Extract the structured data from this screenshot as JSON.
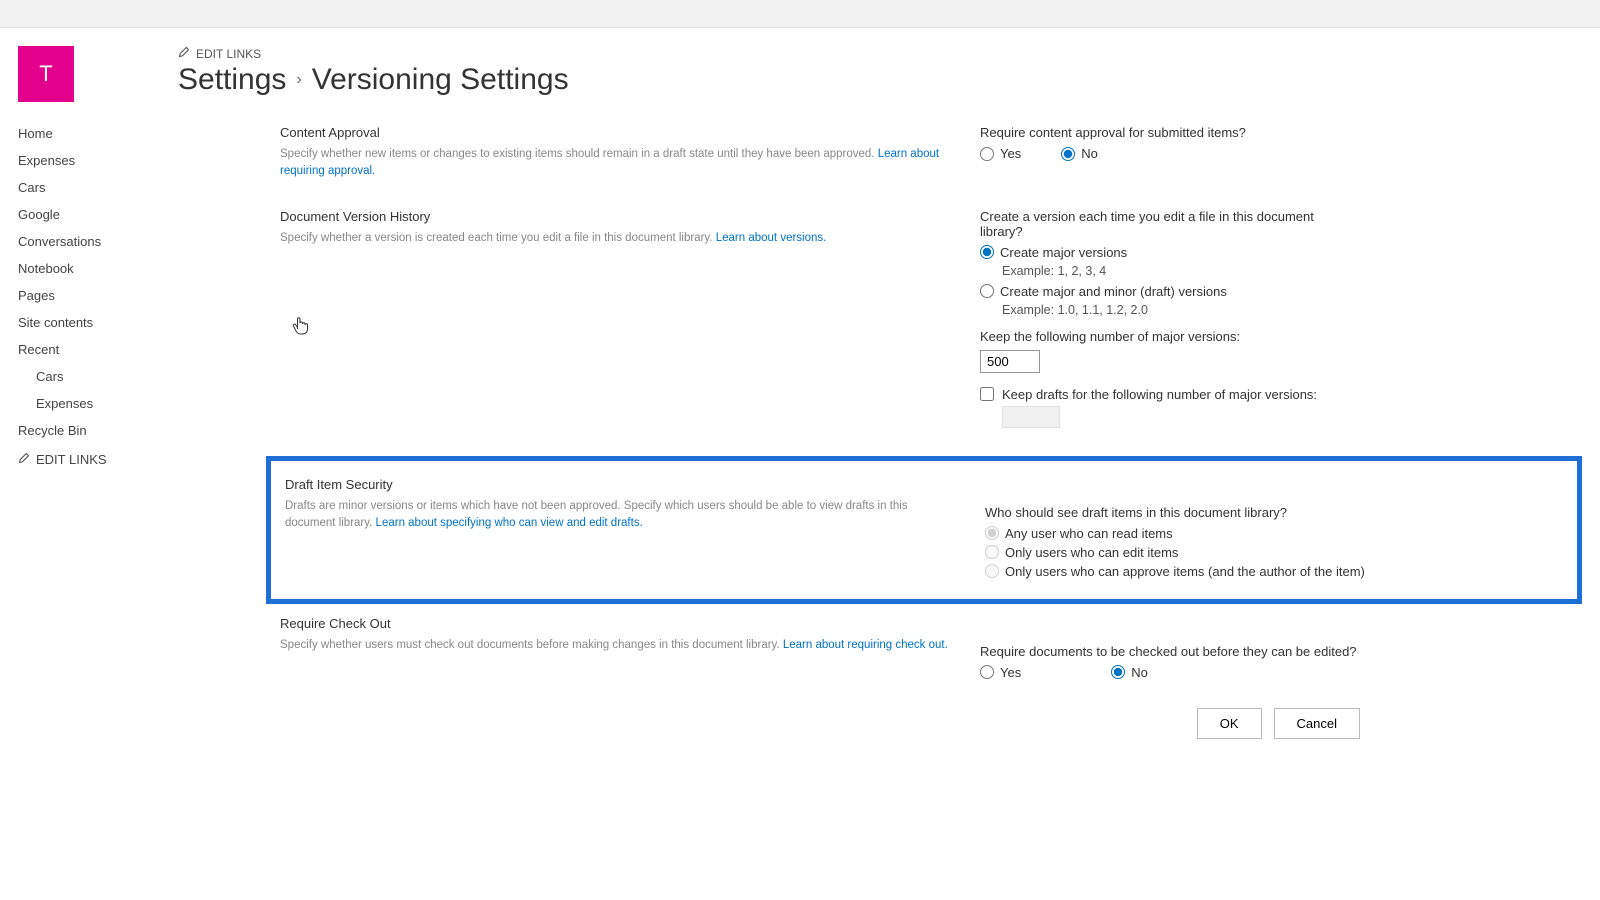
{
  "logo": {
    "letter": "T"
  },
  "editLinksLabel": "EDIT LINKS",
  "breadcrumb": {
    "part1": "Settings",
    "sep": "›",
    "part2": "Versioning Settings"
  },
  "nav": {
    "items": [
      "Home",
      "Expenses",
      "Cars",
      "Google",
      "Conversations",
      "Notebook",
      "Pages",
      "Site contents",
      "Recent"
    ],
    "recentSub": [
      "Cars",
      "Expenses"
    ],
    "recycle": "Recycle Bin",
    "editLinks": "EDIT LINKS"
  },
  "contentApproval": {
    "title": "Content Approval",
    "desc": "Specify whether new items or changes to existing items should remain in a draft state until they have been approved.  ",
    "link": "Learn about requiring approval.",
    "question": "Require content approval for submitted items?",
    "yes": "Yes",
    "no": "No"
  },
  "versionHistory": {
    "title": "Document Version History",
    "desc": "Specify whether a version is created each time you edit a file in this document library.  ",
    "link": "Learn about versions.",
    "question": "Create a version each time you edit a file in this document library?",
    "opt1": "Create major versions",
    "opt1ex": "Example: 1, 2, 3, 4",
    "opt2": "Create major and minor (draft) versions",
    "opt2ex": "Example: 1.0, 1.1, 1.2, 2.0",
    "keepLabel": "Keep the following number of major versions:",
    "keepValue": "500",
    "keepDraftsLabel": "Keep drafts for the following number of major versions:"
  },
  "draftSecurity": {
    "title": "Draft Item Security",
    "desc": "Drafts are minor versions or items which have not been approved. Specify which users should be able to view drafts in this document library.  ",
    "link": "Learn about specifying who can view and edit drafts.",
    "question": "Who should see draft items in this document library?",
    "opt1": "Any user who can read items",
    "opt2": "Only users who can edit items",
    "opt3": "Only users who can approve items (and the author of the item)"
  },
  "requireCheckout": {
    "title": "Require Check Out",
    "desc": "Specify whether users must check out documents before making changes in this document library.  ",
    "link": "Learn about requiring check out.",
    "question": "Require documents to be checked out before they can be edited?",
    "yes": "Yes",
    "no": "No"
  },
  "buttons": {
    "ok": "OK",
    "cancel": "Cancel"
  }
}
